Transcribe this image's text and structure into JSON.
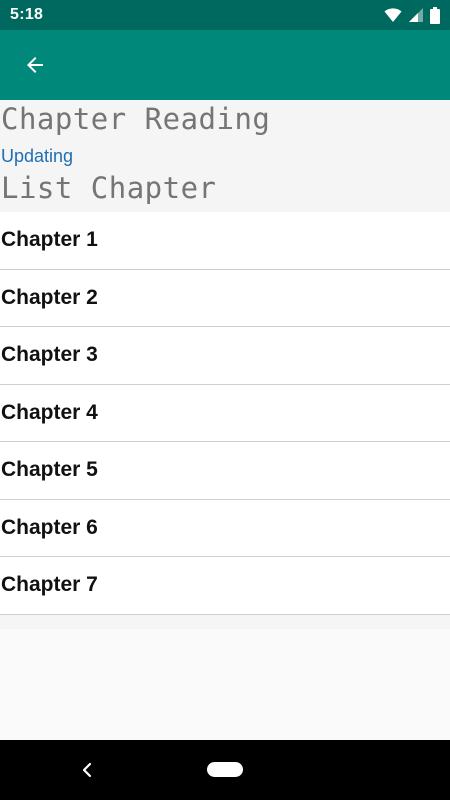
{
  "status_bar": {
    "time": "5:18",
    "icons": [
      "wifi-icon",
      "cell-signal-icon",
      "battery-icon"
    ]
  },
  "app_bar": {
    "back_icon": "arrow-back-icon",
    "color": "#00897b"
  },
  "header": {
    "reading_title": "Chapter Reading",
    "status": "Updating",
    "list_title": "List Chapter"
  },
  "chapters": [
    {
      "label": "Chapter 1"
    },
    {
      "label": "Chapter 2"
    },
    {
      "label": "Chapter 3"
    },
    {
      "label": "Chapter 4"
    },
    {
      "label": "Chapter 5"
    },
    {
      "label": "Chapter 6"
    },
    {
      "label": "Chapter 7"
    }
  ],
  "nav_bar": {
    "back_icon": "nav-back-icon",
    "home_icon": "home-pill-icon"
  },
  "colors": {
    "accent": "#00897b",
    "status_bar": "#00695f",
    "link": "#1e6fb4"
  }
}
